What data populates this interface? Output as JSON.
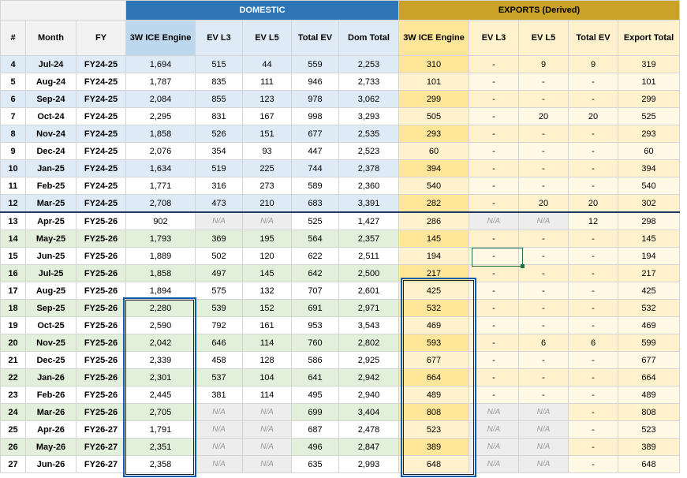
{
  "groups": {
    "domestic": "DOMESTIC",
    "exports": "EXPORTS (Derived)"
  },
  "headers": [
    "#",
    "Month",
    "FY",
    "3W ICE Engine",
    "EV L3",
    "EV L5",
    "Total EV",
    "Dom Total",
    "3W ICE Engine",
    "EV L3",
    "EV L5",
    "Total EV",
    "Export Total"
  ],
  "rows": [
    {
      "idx": "4",
      "month": "Jul-24",
      "fy": "FY24-25",
      "d_ice": "1,694",
      "d_l3": "515",
      "d_l5": "44",
      "d_tev": "559",
      "dom_total": "2,253",
      "e_ice": "310",
      "e_l3": "-",
      "e_l5": "9",
      "e_tev": "9",
      "exp_total": "319"
    },
    {
      "idx": "5",
      "month": "Aug-24",
      "fy": "FY24-25",
      "d_ice": "1,787",
      "d_l3": "835",
      "d_l5": "111",
      "d_tev": "946",
      "dom_total": "2,733",
      "e_ice": "101",
      "e_l3": "-",
      "e_l5": "-",
      "e_tev": "-",
      "exp_total": "101"
    },
    {
      "idx": "6",
      "month": "Sep-24",
      "fy": "FY24-25",
      "d_ice": "2,084",
      "d_l3": "855",
      "d_l5": "123",
      "d_tev": "978",
      "dom_total": "3,062",
      "e_ice": "299",
      "e_l3": "-",
      "e_l5": "-",
      "e_tev": "-",
      "exp_total": "299"
    },
    {
      "idx": "7",
      "month": "Oct-24",
      "fy": "FY24-25",
      "d_ice": "2,295",
      "d_l3": "831",
      "d_l5": "167",
      "d_tev": "998",
      "dom_total": "3,293",
      "e_ice": "505",
      "e_l3": "-",
      "e_l5": "20",
      "e_tev": "20",
      "exp_total": "525"
    },
    {
      "idx": "8",
      "month": "Nov-24",
      "fy": "FY24-25",
      "d_ice": "1,858",
      "d_l3": "526",
      "d_l5": "151",
      "d_tev": "677",
      "dom_total": "2,535",
      "e_ice": "293",
      "e_l3": "-",
      "e_l5": "-",
      "e_tev": "-",
      "exp_total": "293"
    },
    {
      "idx": "9",
      "month": "Dec-24",
      "fy": "FY24-25",
      "d_ice": "2,076",
      "d_l3": "354",
      "d_l5": "93",
      "d_tev": "447",
      "dom_total": "2,523",
      "e_ice": "60",
      "e_l3": "-",
      "e_l5": "-",
      "e_tev": "-",
      "exp_total": "60"
    },
    {
      "idx": "10",
      "month": "Jan-25",
      "fy": "FY24-25",
      "d_ice": "1,634",
      "d_l3": "519",
      "d_l5": "225",
      "d_tev": "744",
      "dom_total": "2,378",
      "e_ice": "394",
      "e_l3": "-",
      "e_l5": "-",
      "e_tev": "-",
      "exp_total": "394"
    },
    {
      "idx": "11",
      "month": "Feb-25",
      "fy": "FY24-25",
      "d_ice": "1,771",
      "d_l3": "316",
      "d_l5": "273",
      "d_tev": "589",
      "dom_total": "2,360",
      "e_ice": "540",
      "e_l3": "-",
      "e_l5": "-",
      "e_tev": "-",
      "exp_total": "540"
    },
    {
      "idx": "12",
      "month": "Mar-25",
      "fy": "FY24-25",
      "d_ice": "2,708",
      "d_l3": "473",
      "d_l5": "210",
      "d_tev": "683",
      "dom_total": "3,391",
      "e_ice": "282",
      "e_l3": "-",
      "e_l5": "20",
      "e_tev": "20",
      "exp_total": "302"
    },
    {
      "idx": "13",
      "month": "Apr-25",
      "fy": "FY25-26",
      "d_ice": "902",
      "d_l3": "N/A",
      "d_l5": "N/A",
      "d_tev": "525",
      "dom_total": "1,427",
      "e_ice": "286",
      "e_l3": "N/A",
      "e_l5": "N/A",
      "e_tev": "12",
      "exp_total": "298"
    },
    {
      "idx": "14",
      "month": "May-25",
      "fy": "FY25-26",
      "d_ice": "1,793",
      "d_l3": "369",
      "d_l5": "195",
      "d_tev": "564",
      "dom_total": "2,357",
      "e_ice": "145",
      "e_l3": "-",
      "e_l5": "-",
      "e_tev": "-",
      "exp_total": "145"
    },
    {
      "idx": "15",
      "month": "Jun-25",
      "fy": "FY25-26",
      "d_ice": "1,889",
      "d_l3": "502",
      "d_l5": "120",
      "d_tev": "622",
      "dom_total": "2,511",
      "e_ice": "194",
      "e_l3": "-",
      "e_l5": "-",
      "e_tev": "-",
      "exp_total": "194"
    },
    {
      "idx": "16",
      "month": "Jul-25",
      "fy": "FY25-26",
      "d_ice": "1,858",
      "d_l3": "497",
      "d_l5": "145",
      "d_tev": "642",
      "dom_total": "2,500",
      "e_ice": "217",
      "e_l3": "-",
      "e_l5": "-",
      "e_tev": "-",
      "exp_total": "217"
    },
    {
      "idx": "17",
      "month": "Aug-25",
      "fy": "FY25-26",
      "d_ice": "1,894",
      "d_l3": "575",
      "d_l5": "132",
      "d_tev": "707",
      "dom_total": "2,601",
      "e_ice": "425",
      "e_l3": "-",
      "e_l5": "-",
      "e_tev": "-",
      "exp_total": "425"
    },
    {
      "idx": "18",
      "month": "Sep-25",
      "fy": "FY25-26",
      "d_ice": "2,280",
      "d_l3": "539",
      "d_l5": "152",
      "d_tev": "691",
      "dom_total": "2,971",
      "e_ice": "532",
      "e_l3": "-",
      "e_l5": "-",
      "e_tev": "-",
      "exp_total": "532"
    },
    {
      "idx": "19",
      "month": "Oct-25",
      "fy": "FY25-26",
      "d_ice": "2,590",
      "d_l3": "792",
      "d_l5": "161",
      "d_tev": "953",
      "dom_total": "3,543",
      "e_ice": "469",
      "e_l3": "-",
      "e_l5": "-",
      "e_tev": "-",
      "exp_total": "469"
    },
    {
      "idx": "20",
      "month": "Nov-25",
      "fy": "FY25-26",
      "d_ice": "2,042",
      "d_l3": "646",
      "d_l5": "114",
      "d_tev": "760",
      "dom_total": "2,802",
      "e_ice": "593",
      "e_l3": "-",
      "e_l5": "6",
      "e_tev": "6",
      "exp_total": "599"
    },
    {
      "idx": "21",
      "month": "Dec-25",
      "fy": "FY25-26",
      "d_ice": "2,339",
      "d_l3": "458",
      "d_l5": "128",
      "d_tev": "586",
      "dom_total": "2,925",
      "e_ice": "677",
      "e_l3": "-",
      "e_l5": "-",
      "e_tev": "-",
      "exp_total": "677"
    },
    {
      "idx": "22",
      "month": "Jan-26",
      "fy": "FY25-26",
      "d_ice": "2,301",
      "d_l3": "537",
      "d_l5": "104",
      "d_tev": "641",
      "dom_total": "2,942",
      "e_ice": "664",
      "e_l3": "-",
      "e_l5": "-",
      "e_tev": "-",
      "exp_total": "664"
    },
    {
      "idx": "23",
      "month": "Feb-26",
      "fy": "FY25-26",
      "d_ice": "2,445",
      "d_l3": "381",
      "d_l5": "114",
      "d_tev": "495",
      "dom_total": "2,940",
      "e_ice": "489",
      "e_l3": "-",
      "e_l5": "-",
      "e_tev": "-",
      "exp_total": "489"
    },
    {
      "idx": "24",
      "month": "Mar-26",
      "fy": "FY25-26",
      "d_ice": "2,705",
      "d_l3": "N/A",
      "d_l5": "N/A",
      "d_tev": "699",
      "dom_total": "3,404",
      "e_ice": "808",
      "e_l3": "N/A",
      "e_l5": "N/A",
      "e_tev": "-",
      "exp_total": "808"
    },
    {
      "idx": "25",
      "month": "Apr-26",
      "fy": "FY26-27",
      "d_ice": "1,791",
      "d_l3": "N/A",
      "d_l5": "N/A",
      "d_tev": "687",
      "dom_total": "2,478",
      "e_ice": "523",
      "e_l3": "N/A",
      "e_l5": "N/A",
      "e_tev": "-",
      "exp_total": "523"
    },
    {
      "idx": "26",
      "month": "May-26",
      "fy": "FY26-27",
      "d_ice": "2,351",
      "d_l3": "N/A",
      "d_l5": "N/A",
      "d_tev": "496",
      "dom_total": "2,847",
      "e_ice": "389",
      "e_l3": "N/A",
      "e_l5": "N/A",
      "e_tev": "-",
      "exp_total": "389"
    },
    {
      "idx": "27",
      "month": "Jun-26",
      "fy": "FY26-27",
      "d_ice": "2,358",
      "d_l3": "N/A",
      "d_l5": "N/A",
      "d_tev": "635",
      "dom_total": "2,993",
      "e_ice": "648",
      "e_l3": "N/A",
      "e_l5": "N/A",
      "e_tev": "-",
      "exp_total": "648"
    }
  ],
  "colors": {
    "domestic_header": "#2e75b6",
    "exports_header": "#c9a227",
    "selection": "#0b5cad",
    "active_cell": "#217346"
  }
}
